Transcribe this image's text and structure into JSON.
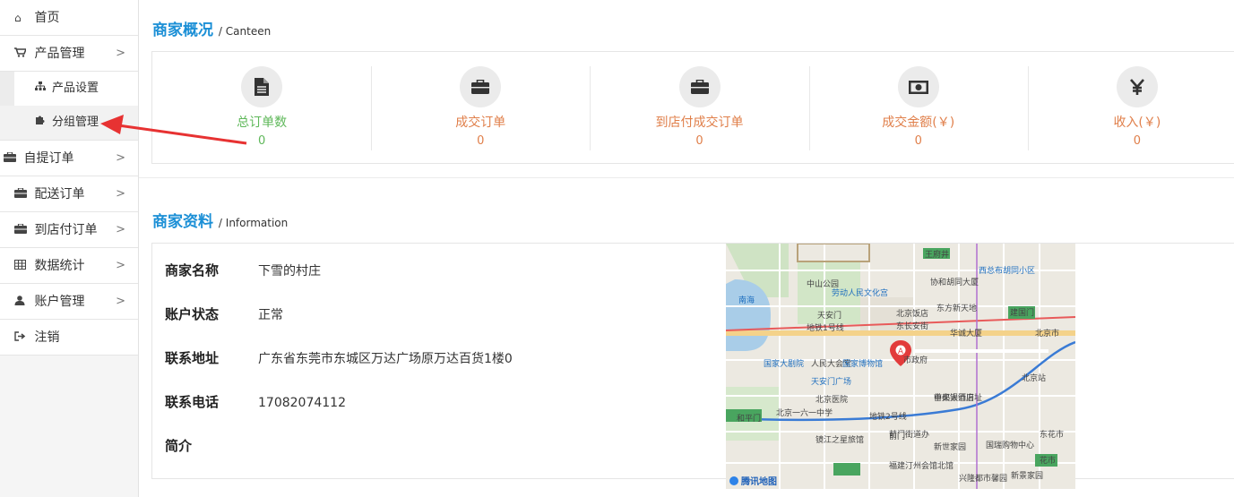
{
  "sidebar": {
    "items": [
      {
        "label": "首页",
        "icon": "home-icon"
      },
      {
        "label": "产品管理",
        "icon": "cart-icon"
      },
      {
        "label": "自提订单",
        "icon": "briefcase-icon"
      },
      {
        "label": "配送订单",
        "icon": "briefcase-icon"
      },
      {
        "label": "到店付订单",
        "icon": "briefcase-icon"
      },
      {
        "label": "数据统计",
        "icon": "table-icon"
      },
      {
        "label": "账户管理",
        "icon": "user-icon"
      },
      {
        "label": "注销",
        "icon": "signout-icon"
      }
    ],
    "sub_items": [
      {
        "label": "产品设置",
        "icon": "sitemap-icon"
      },
      {
        "label": "分组管理",
        "icon": "puzzle-icon"
      }
    ],
    "arrow_glyph": ">"
  },
  "overview": {
    "title": "商家概况",
    "subtitle": "/ Canteen",
    "stats": [
      {
        "label": "总订单数",
        "value": "0",
        "icon": "file-icon",
        "color": "#5fb85a"
      },
      {
        "label": "成交订单",
        "value": "0",
        "icon": "briefcase-icon",
        "color": "#e07f4a"
      },
      {
        "label": "到店付成交订单",
        "value": "0",
        "icon": "briefcase-icon",
        "color": "#e07f4a"
      },
      {
        "label": "成交金额(￥)",
        "value": "0",
        "icon": "money-icon",
        "color": "#e07f4a"
      },
      {
        "label": "收入(￥)",
        "value": "0",
        "icon": "yen-icon",
        "color": "#e07f4a"
      }
    ]
  },
  "profile": {
    "title": "商家资料",
    "subtitle": "/ Information",
    "fields": [
      {
        "key": "商家名称",
        "value": "下雪的村庄"
      },
      {
        "key": "账户状态",
        "value": "正常"
      },
      {
        "key": "联系地址",
        "value": "广东省东莞市东城区万达广场原万达百货1楼0"
      },
      {
        "key": "联系电话",
        "value": "17082074112"
      },
      {
        "key": "简介",
        "value": ""
      }
    ]
  },
  "map": {
    "provider": "腾讯地图",
    "marker": "A",
    "labels": [
      {
        "text": "王府井"
      },
      {
        "text": "西总布胡同小区"
      },
      {
        "text": "中山公园"
      },
      {
        "text": "劳动人民文化宫"
      },
      {
        "text": "协和胡同大厦"
      },
      {
        "text": "南海"
      },
      {
        "text": "东方新天地"
      },
      {
        "text": "天安门"
      },
      {
        "text": "北京饭店"
      },
      {
        "text": "东长安街"
      },
      {
        "text": "地铁1号线"
      },
      {
        "text": "建国门"
      },
      {
        "text": "华诚大厦"
      },
      {
        "text": "北京市"
      },
      {
        "text": "国家大剧院"
      },
      {
        "text": "人民大会堂"
      },
      {
        "text": "国家博物馆"
      },
      {
        "text": "市政府"
      },
      {
        "text": "地铁2号线"
      },
      {
        "text": "北京站"
      },
      {
        "text": "天安门广场"
      },
      {
        "text": "北京医院"
      },
      {
        "text": "中央银行旧址"
      },
      {
        "text": "首都大酒店"
      },
      {
        "text": "和平门"
      },
      {
        "text": "北京一六一中学"
      },
      {
        "text": "前门"
      },
      {
        "text": "新世家园"
      },
      {
        "text": "国瑞购物中心"
      },
      {
        "text": "东花市"
      },
      {
        "text": "花市"
      },
      {
        "text": "新景家园"
      },
      {
        "text": "前门街道办"
      },
      {
        "text": "福建汀州会馆北馆"
      },
      {
        "text": "兴隆都市馨园"
      },
      {
        "text": "镜江之星旅馆"
      }
    ]
  }
}
